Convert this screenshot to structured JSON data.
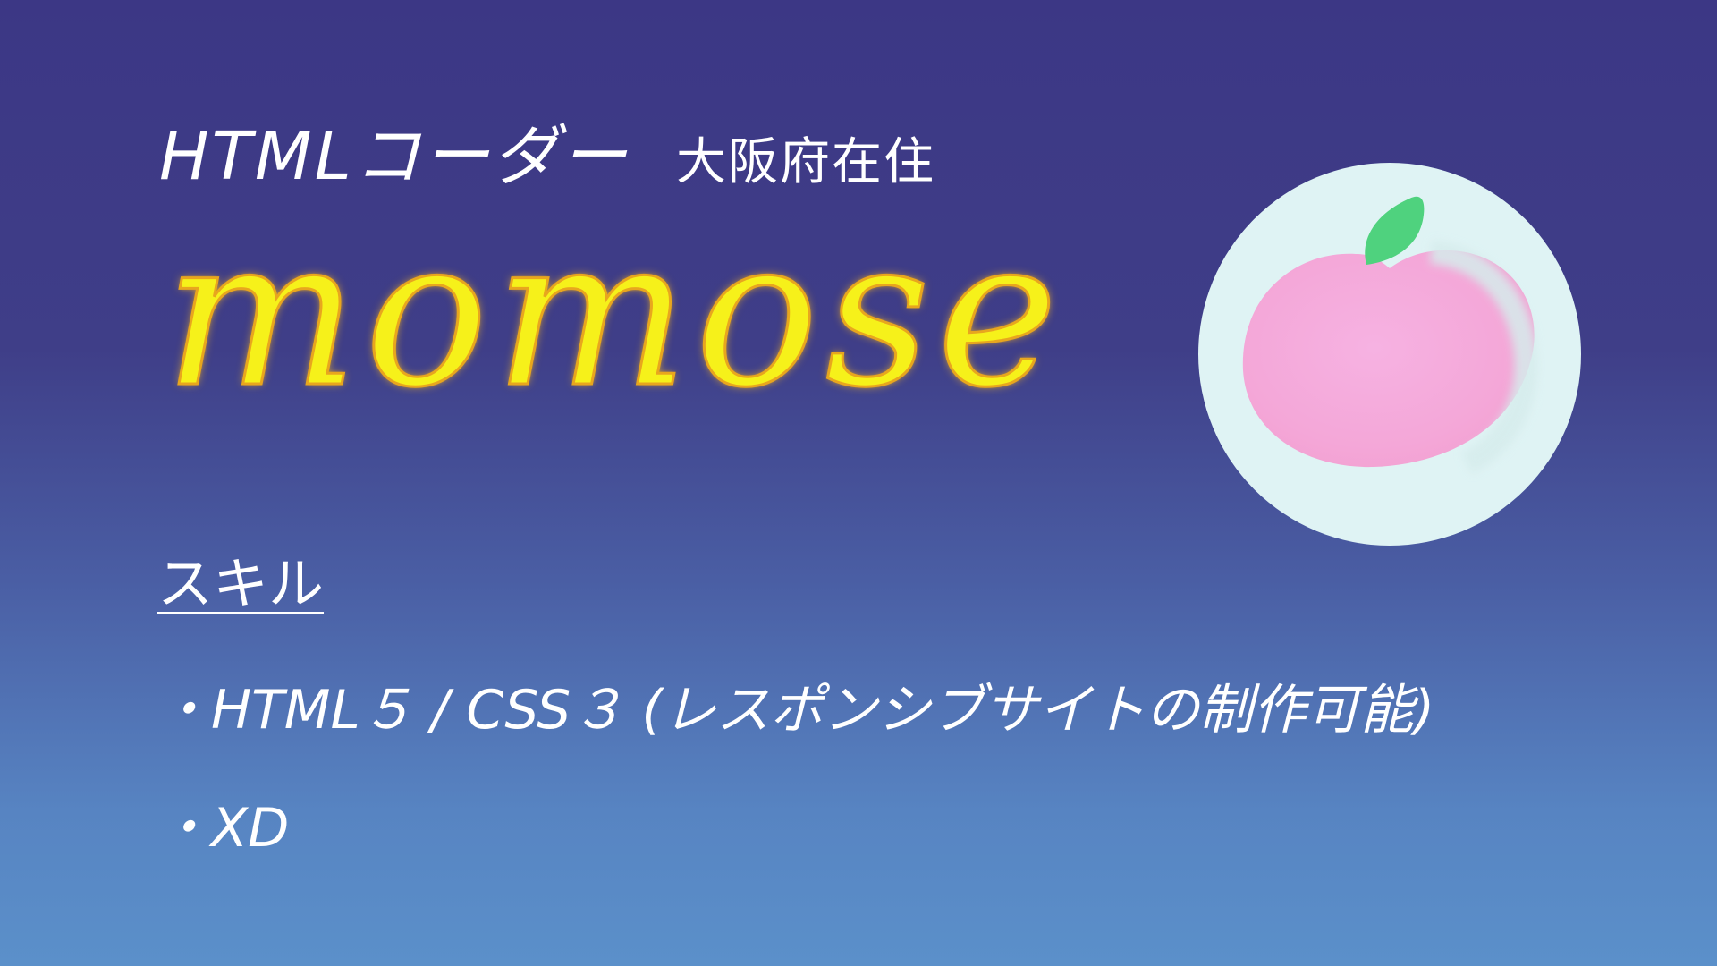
{
  "header": {
    "role": "HTMLコーダー",
    "location": "大阪府在住"
  },
  "name": "momose",
  "skills": {
    "heading": "スキル",
    "items": [
      "・HTML５ / CSS３ (レスポンシブサイトの制作可能)",
      "・XD"
    ]
  },
  "avatar": {
    "icon": "peach-icon",
    "colors": {
      "circle": "#dff3f4",
      "peach": "#f4a9d9",
      "leaf": "#4fd27e"
    }
  },
  "colors": {
    "background_top": "#3c3785",
    "background_bottom": "#5b90ca",
    "name_fill": "#f6f11a",
    "name_outline": "#e8a61e",
    "text": "#ffffff"
  }
}
